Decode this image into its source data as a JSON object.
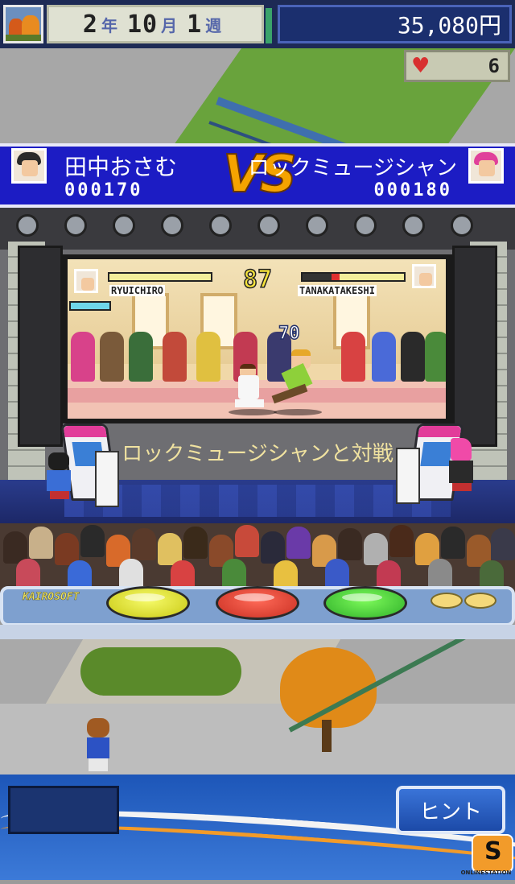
{
  "status_bar": {
    "year": "2",
    "year_unit": "年",
    "month": "10",
    "month_unit": "月",
    "week": "1",
    "week_unit": "週",
    "money": "35,080円",
    "hearts": "6"
  },
  "match": {
    "player1_name": "田中おさむ",
    "player1_score": "000170",
    "player2_name": "ロックミュージシャン",
    "player2_score": "000180",
    "vs_label": "VS"
  },
  "arcade_screen": {
    "fighter1_name": "RYUICHIRO",
    "fighter2_name": "TANAKATAKESHI",
    "timer": "87",
    "combo_number": "70",
    "fighter1_hp": 1.0,
    "fighter2_hp": 0.68
  },
  "caption": "ロックミュージシャンと対戦",
  "controls": {
    "brand": "KAIROSOFT",
    "buttons": [
      "yellow",
      "red",
      "green"
    ]
  },
  "hint_button": "ヒント",
  "watermark": {
    "letter": "S",
    "text": "ONLINESTATION"
  },
  "icons": {
    "season": "autumn-tree-icon",
    "heart": "heart-icon"
  }
}
